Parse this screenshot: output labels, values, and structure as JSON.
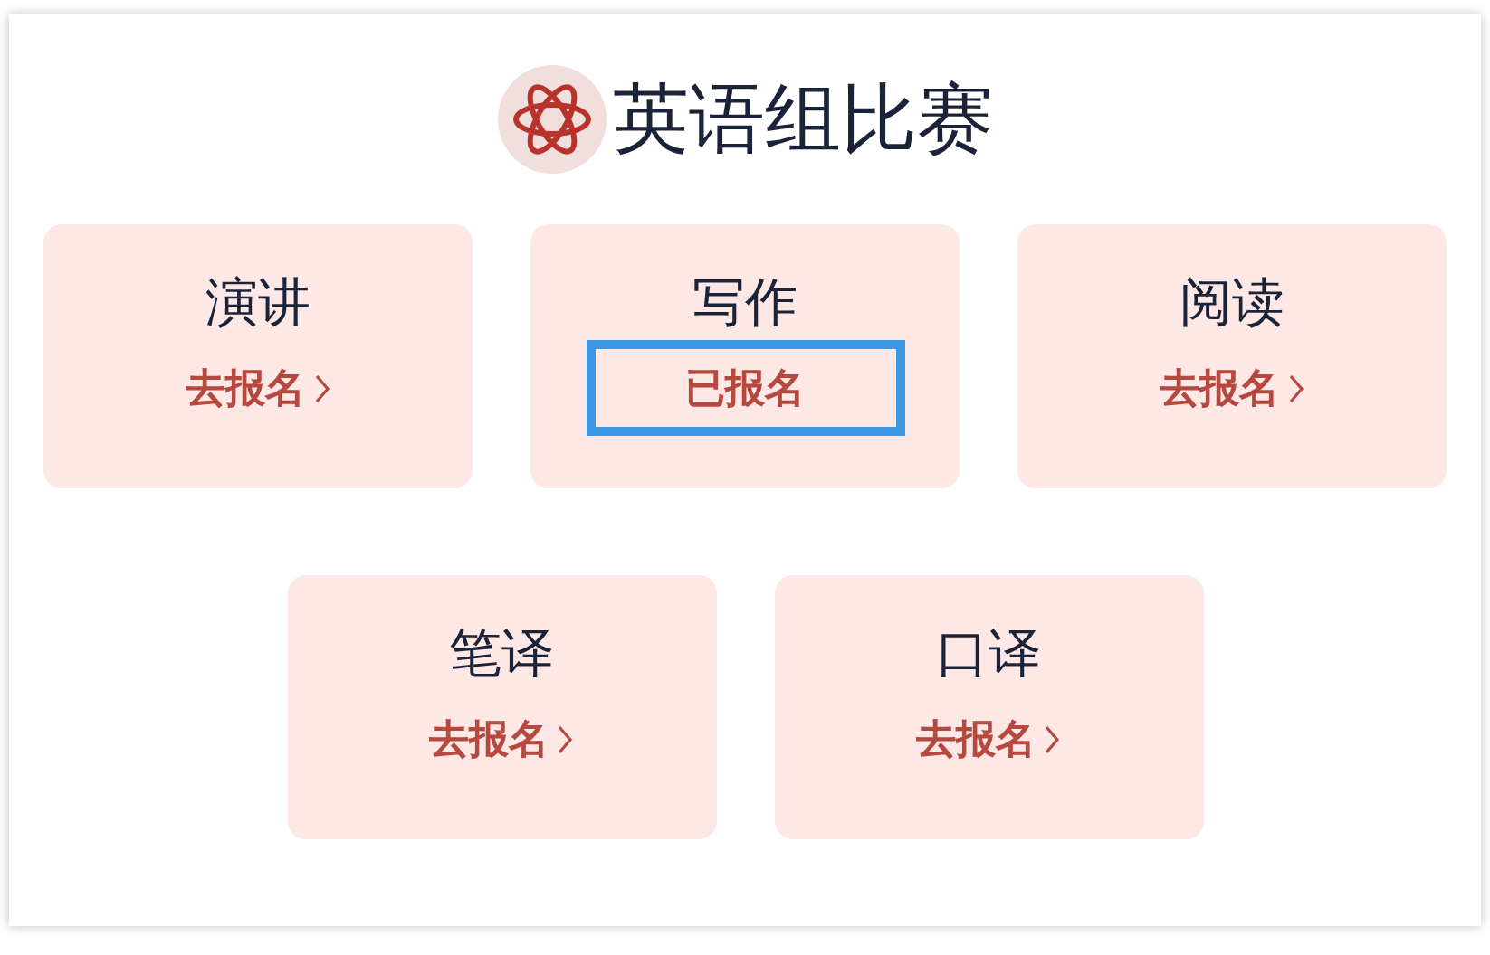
{
  "title": "英语组比赛",
  "rows": [
    [
      {
        "name": "演讲",
        "action": "去报名",
        "registered": false
      },
      {
        "name": "写作",
        "action": "已报名",
        "registered": true
      },
      {
        "name": "阅读",
        "action": "去报名",
        "registered": false
      }
    ],
    [
      {
        "name": "笔译",
        "action": "去报名",
        "registered": false
      },
      {
        "name": "口译",
        "action": "去报名",
        "registered": false
      }
    ]
  ]
}
